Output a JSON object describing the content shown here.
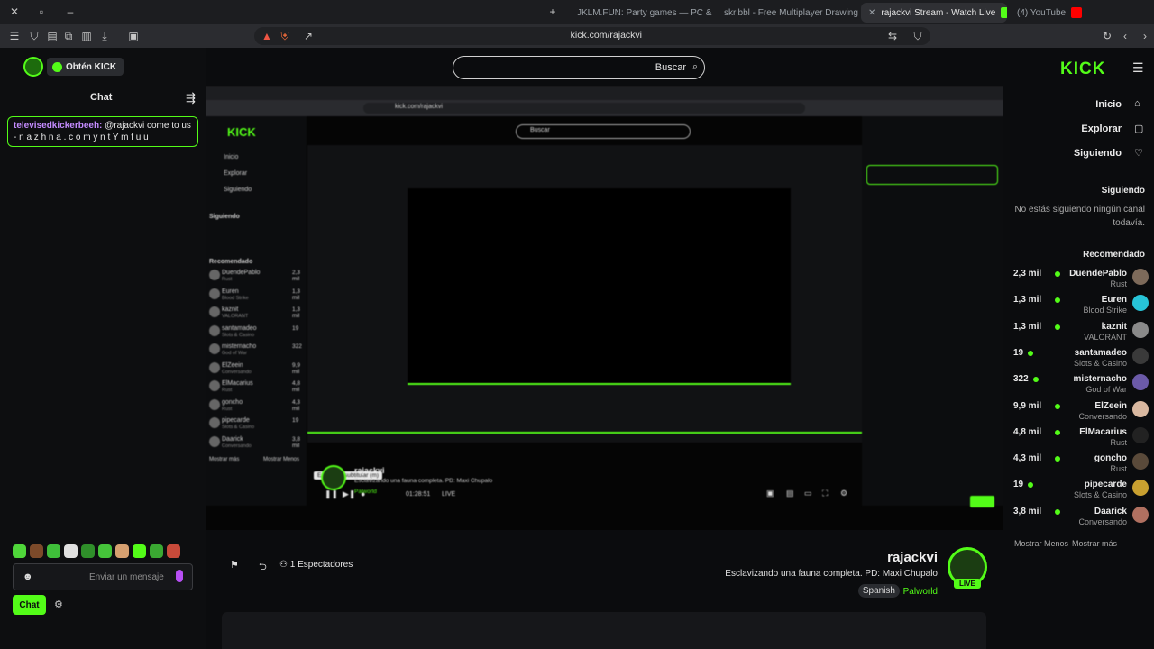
{
  "tabs": [
    {
      "title": "(4) YouTube",
      "active": false
    },
    {
      "title": "rajackvi Stream - Watch Live",
      "active": true
    },
    {
      "title": "skribbl - Free Multiplayer Drawing &",
      "active": false
    },
    {
      "title": "JKLM.FUN: Party games — PC & Sm",
      "active": false
    }
  ],
  "toolbar": {
    "url": "kick.com/rajackvi"
  },
  "chat": {
    "get_kick_label": "Obtén KICK",
    "title": "Chat",
    "pinned_user": "televisedkickerbeeh:",
    "pinned_text": "@rajackvi come to us - n a z h n a . c o m y n t Y m f u u",
    "input_placeholder": "Enviar un mensaje",
    "send_label": "Chat"
  },
  "search": {
    "placeholder": "Buscar"
  },
  "stream": {
    "streamer_name": "rajackvi",
    "title": "Esclavizando una fauna completa. PD: Maxi Chupalo",
    "game": "Palworld",
    "language": "Spanish",
    "live_badge": "LIVE",
    "viewers": "1 Espectadores"
  },
  "nav": {
    "logo": "KICK",
    "items": [
      {
        "label": "Inicio",
        "icon": "home-icon"
      },
      {
        "label": "Explorar",
        "icon": "compass-icon"
      },
      {
        "label": "Siguiendo",
        "icon": "heart-icon"
      }
    ],
    "following_heading": "Siguiendo",
    "following_empty": "No estás siguiendo ningún canal todavía.",
    "recommended_heading": "Recomendado",
    "recommended": [
      {
        "name": "DuendePablo",
        "game": "Rust",
        "viewers": "2,3 mil",
        "color": "#7d6a5a"
      },
      {
        "name": "Euren",
        "game": "Blood Strike",
        "viewers": "1,3 mil",
        "color": "#27c4d8"
      },
      {
        "name": "kaznit",
        "game": "VALORANT",
        "viewers": "1,3 mil",
        "color": "#8a8a8a"
      },
      {
        "name": "santamadeo",
        "game": "Slots & Casino",
        "viewers": "19",
        "color": "#3a3a3a"
      },
      {
        "name": "misternacho",
        "game": "God of War",
        "viewers": "322",
        "color": "#6b5aa8"
      },
      {
        "name": "ElZeein",
        "game": "Conversando",
        "viewers": "9,9 mil",
        "color": "#d9b8a0"
      },
      {
        "name": "ElMacarius",
        "game": "Rust",
        "viewers": "4,8 mil",
        "color": "#222222"
      },
      {
        "name": "goncho",
        "game": "Rust",
        "viewers": "4,3 mil",
        "color": "#5a4a3a"
      },
      {
        "name": "pipecarde",
        "game": "Slots & Casino",
        "viewers": "19",
        "color": "#c9a030"
      },
      {
        "name": "Daarick",
        "game": "Conversando",
        "viewers": "3,8 mil",
        "color": "#b07060"
      }
    ],
    "show_more": "Mostrar más",
    "show_less": "Mostrar Menos"
  },
  "inner": {
    "url": "kick.com/rajackvi",
    "search": "Buscar",
    "tooltip": "Entrar del subtitular (m)",
    "time": "01:28:51",
    "live": "LIVE",
    "name": "rajackvi",
    "title": "Esclavizando una fauna completa. PD: Maxi Chupalo",
    "game": "Palworld",
    "nav": [
      "Inicio",
      "Explorar",
      "Siguiendo"
    ],
    "recommended_heading": "Recomendado",
    "following_heading": "Siguiendo",
    "list": [
      {
        "name": "DuendePablo",
        "game": "Rust",
        "v": "2,3 mil"
      },
      {
        "name": "Euren",
        "game": "Blood Strike",
        "v": "1,3 mil"
      },
      {
        "name": "kaznit",
        "game": "VALORANT",
        "v": "1,3 mil"
      },
      {
        "name": "santamadeo",
        "game": "Slots & Casino",
        "v": "19"
      },
      {
        "name": "misternacho",
        "game": "God of War",
        "v": "322"
      },
      {
        "name": "ElZeein",
        "game": "Conversando",
        "v": "9,9 mil"
      },
      {
        "name": "ElMacarius",
        "game": "Rust",
        "v": "4,8 mil"
      },
      {
        "name": "goncho",
        "game": "Rust",
        "v": "4,3 mil"
      },
      {
        "name": "pipecarde",
        "game": "Slots & Casino",
        "v": "19"
      },
      {
        "name": "Daarick",
        "game": "Conversando",
        "v": "3,8 mil"
      }
    ],
    "show_more": "Mostrar más",
    "show_less": "Mostrar Menos"
  },
  "colors": {
    "accent": "#53fc18",
    "background": "#0b0c0e"
  }
}
